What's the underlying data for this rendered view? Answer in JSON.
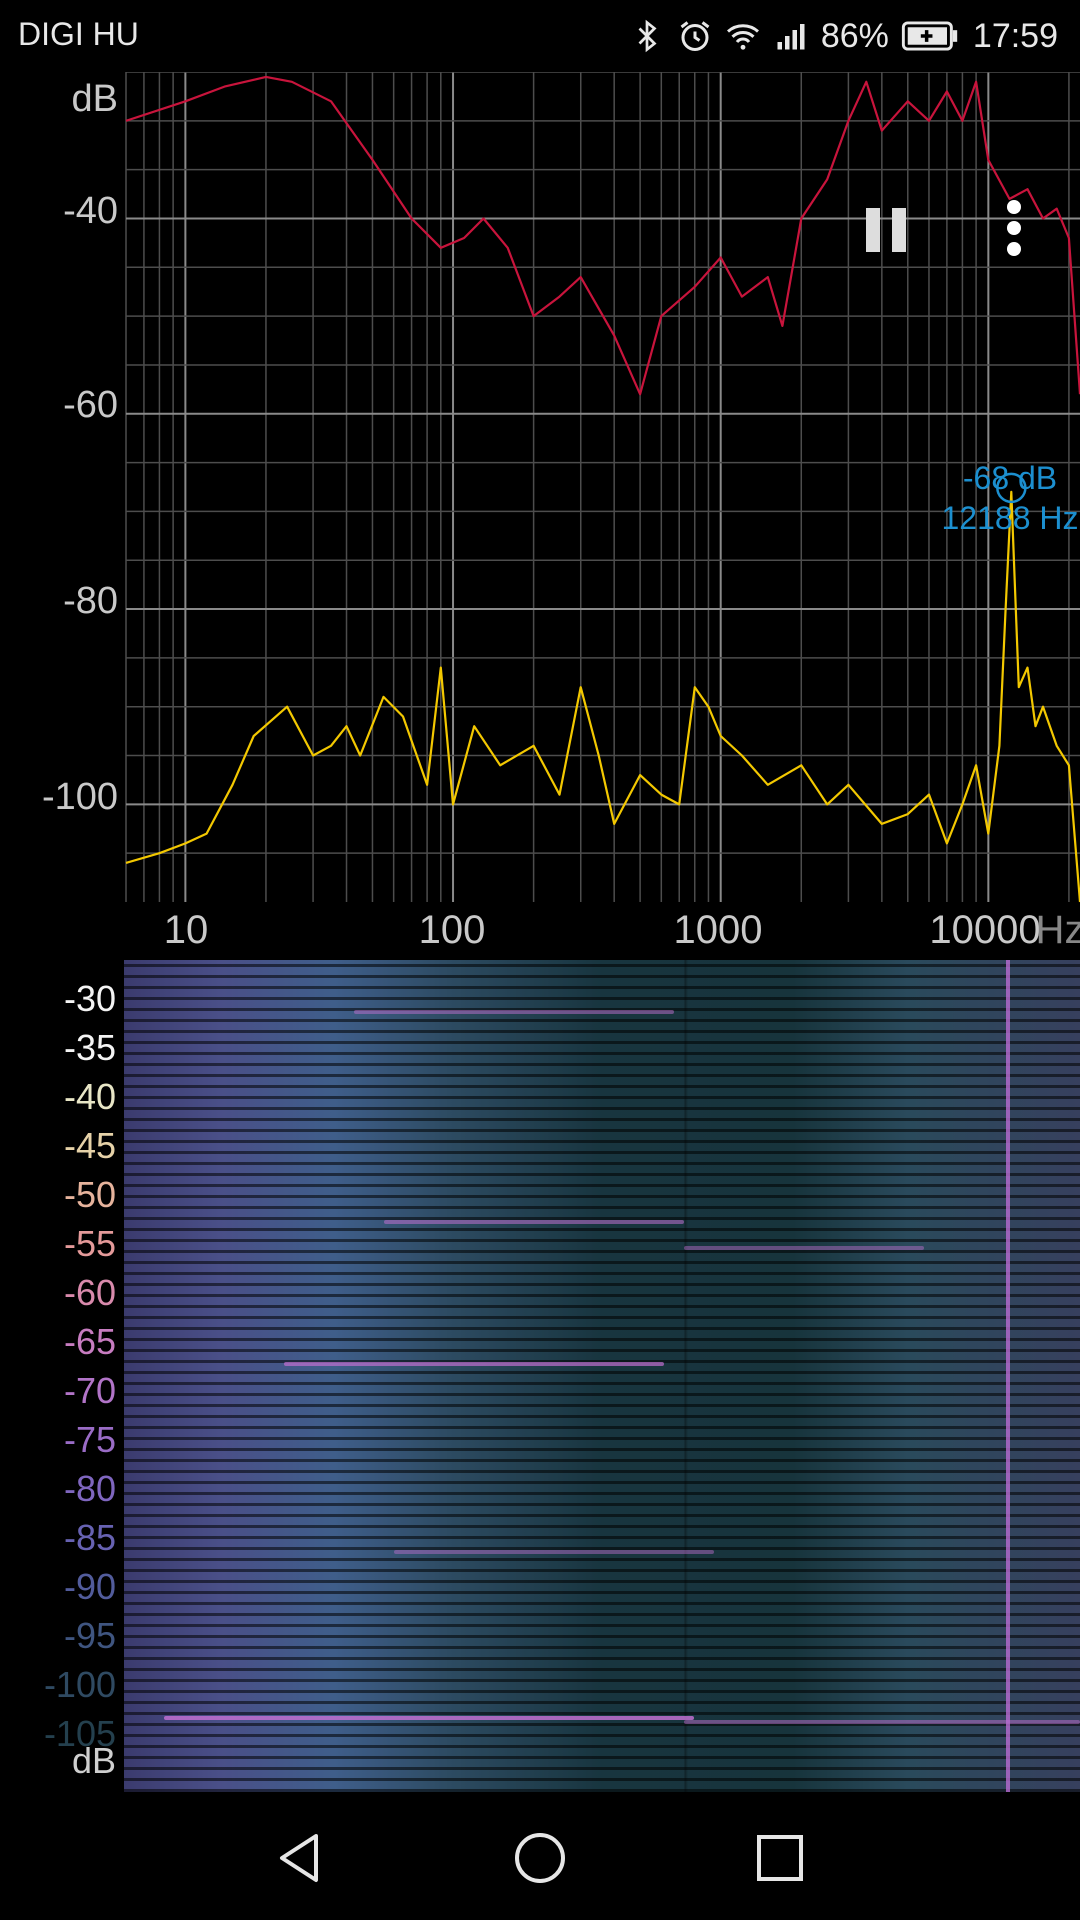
{
  "status_bar": {
    "carrier": "DIGI HU",
    "battery": "86%",
    "time": "17:59",
    "icons": [
      "bluetooth-icon",
      "alarm-icon",
      "wifi-icon",
      "signal-icon",
      "battery-charging-icon"
    ]
  },
  "spectrum": {
    "y_unit": "dB",
    "y_ticks": [
      "-40",
      "-60",
      "-80",
      "-100"
    ],
    "x_ticks": [
      "10",
      "100",
      "1000",
      "10000"
    ],
    "x_unit": "Hz",
    "peak_db": "-68 dB",
    "peak_freq": "12188 Hz",
    "cursor_freq": "12188",
    "colors": {
      "max_trace": "#c8143c",
      "live_trace": "#f3c800",
      "peak_marker": "#1c8fcf",
      "grid": "#6a6a6a"
    }
  },
  "controls": {
    "pause_icon": "pause-icon",
    "menu_icon": "more-vertical-icon"
  },
  "spectrogram": {
    "colorbar_unit": "dB",
    "colorbar_labels": [
      "-30",
      "-35",
      "-40",
      "-45",
      "-50",
      "-55",
      "-60",
      "-65",
      "-70",
      "-75",
      "-80",
      "-85",
      "-90",
      "-95",
      "-100",
      "-105"
    ]
  },
  "navigation": {
    "back_icon": "back-triangle-icon",
    "home_icon": "home-circle-icon",
    "recents_icon": "recents-square-icon"
  },
  "chart_data": {
    "type": "line",
    "title": "",
    "xlabel": "Hz",
    "ylabel": "dB",
    "x_scale": "log",
    "xlim": [
      6,
      22000
    ],
    "ylim": [
      -110,
      -25
    ],
    "grid": true,
    "series": [
      {
        "color": "#c8143c",
        "x": [
          6,
          10,
          14,
          20,
          25,
          35,
          50,
          70,
          90,
          110,
          130,
          160,
          200,
          250,
          300,
          400,
          500,
          600,
          800,
          1000,
          1200,
          1500,
          1700,
          2000,
          2500,
          3000,
          3500,
          4000,
          5000,
          6000,
          7000,
          8000,
          9000,
          10000,
          12000,
          14000,
          16000,
          18000,
          20000,
          22000
        ],
        "y": [
          -30,
          -28,
          -26.5,
          -25.5,
          -26,
          -28,
          -34,
          -40,
          -43,
          -42,
          -40,
          -43,
          -50,
          -48,
          -46,
          -52,
          -58,
          -50,
          -47,
          -44,
          -48,
          -46,
          -51,
          -40,
          -36,
          -30,
          -26,
          -31,
          -28,
          -30,
          -27,
          -30,
          -26,
          -34,
          -38,
          -37,
          -40,
          -39,
          -42,
          -58
        ]
      },
      {
        "color": "#f3c800",
        "x": [
          6,
          8,
          10,
          12,
          15,
          18,
          24,
          30,
          35,
          40,
          45,
          55,
          65,
          80,
          90,
          100,
          120,
          150,
          200,
          250,
          300,
          350,
          400,
          500,
          600,
          700,
          800,
          900,
          1000,
          1200,
          1500,
          2000,
          2500,
          3000,
          4000,
          5000,
          6000,
          7000,
          8000,
          9000,
          10000,
          11000,
          11600,
          12188,
          13000,
          14000,
          15000,
          16000,
          18000,
          20000,
          22000
        ],
        "y": [
          -106,
          -105,
          -104,
          -103,
          -98,
          -93,
          -90,
          -95,
          -94,
          -92,
          -95,
          -89,
          -91,
          -98,
          -86,
          -100,
          -92,
          -96,
          -94,
          -99,
          -88,
          -95,
          -102,
          -97,
          -99,
          -100,
          -88,
          -90,
          -93,
          -95,
          -98,
          -96,
          -100,
          -98,
          -102,
          -101,
          -99,
          -104,
          -100,
          -96,
          -103,
          -94,
          -80,
          -68,
          -88,
          -86,
          -92,
          -90,
          -94,
          -96,
          -110
        ]
      }
    ]
  }
}
